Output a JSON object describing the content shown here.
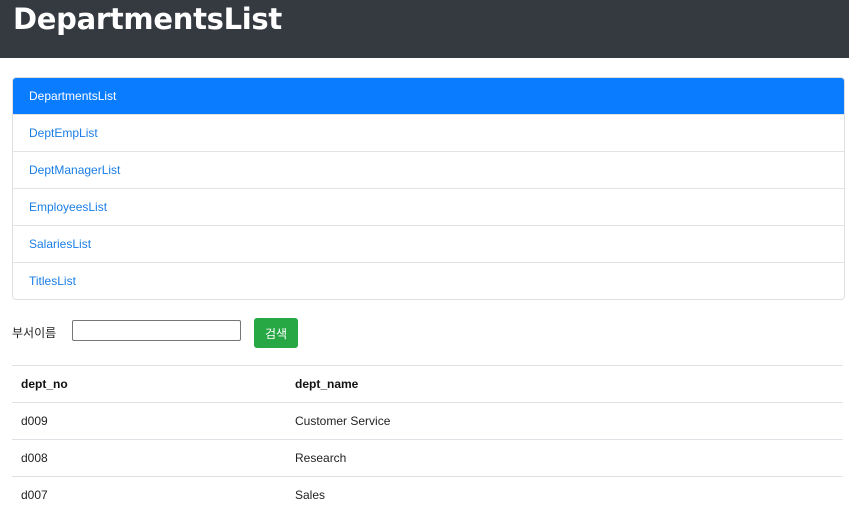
{
  "header": {
    "title": "DepartmentsList"
  },
  "nav": {
    "items": [
      {
        "label": "DepartmentsList",
        "active": true
      },
      {
        "label": "DeptEmpList",
        "active": false
      },
      {
        "label": "DeptManagerList",
        "active": false
      },
      {
        "label": "EmployeesList",
        "active": false
      },
      {
        "label": "SalariesList",
        "active": false
      },
      {
        "label": "TitlesList",
        "active": false
      }
    ]
  },
  "search": {
    "label": "부서이름",
    "value": "",
    "button_label": "검색"
  },
  "table": {
    "columns": [
      "dept_no",
      "dept_name"
    ],
    "rows": [
      [
        "d009",
        "Customer Service"
      ],
      [
        "d008",
        "Research"
      ],
      [
        "d007",
        "Sales"
      ]
    ]
  },
  "colors": {
    "header_bg": "#343a40",
    "active": "#0a7cff",
    "link": "#1a7ee6",
    "button": "#28a745"
  }
}
